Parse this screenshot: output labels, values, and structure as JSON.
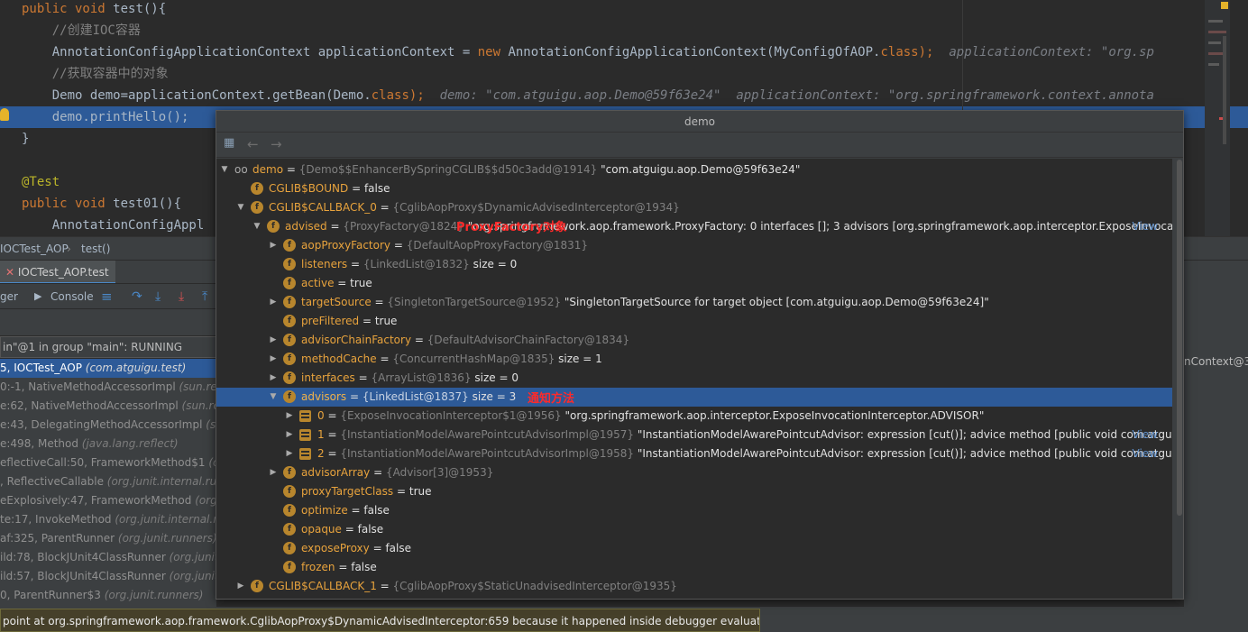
{
  "editor": {
    "lines": [
      {
        "segments": [
          {
            "t": "public void ",
            "c": "kw"
          },
          {
            "t": "test",
            "c": ""
          },
          {
            "t": "(){",
            "c": ""
          }
        ]
      },
      {
        "segments": [
          {
            "t": "    //创建IOC容器",
            "c": "cm"
          }
        ]
      },
      {
        "segments": [
          {
            "t": "    AnnotationConfigApplicationContext applicationContext = ",
            "c": ""
          },
          {
            "t": "new ",
            "c": "kw"
          },
          {
            "t": "AnnotationConfigApplicationContext(MyConfigOfAOP.",
            "c": ""
          },
          {
            "t": "class",
            "c": "kw"
          },
          {
            "t": ");",
            "c": "kw"
          },
          {
            "t": "  applicationContext: \"org.sp",
            "c": "inl"
          }
        ]
      },
      {
        "segments": [
          {
            "t": "    //获取容器中的对象",
            "c": "cm"
          }
        ]
      },
      {
        "segments": [
          {
            "t": "    Demo demo=applicationContext.getBean(Demo.",
            "c": ""
          },
          {
            "t": "class",
            "c": "kw"
          },
          {
            "t": ");",
            "c": "kw"
          },
          {
            "t": "  demo: \"com.atguigu.aop.Demo@59f63e24\"  applicationContext: \"org.springframework.context.annota",
            "c": "inl"
          }
        ]
      },
      {
        "segments": [
          {
            "t": "    demo.printHello();",
            "c": ""
          }
        ]
      },
      {
        "segments": [
          {
            "t": "}",
            "c": ""
          }
        ]
      },
      {
        "segments": [
          {
            "t": "",
            "c": ""
          }
        ]
      },
      {
        "segments": [
          {
            "t": "@Test",
            "c": "an"
          }
        ]
      },
      {
        "segments": [
          {
            "t": "public void ",
            "c": "kw"
          },
          {
            "t": "test01",
            "c": ""
          },
          {
            "t": "(){",
            "c": ""
          }
        ]
      },
      {
        "segments": [
          {
            "t": "    AnnotationConfigAppl",
            "c": ""
          }
        ]
      }
    ]
  },
  "breadcrumb": {
    "class_name": "IOCTest_AOP",
    "separator": "›",
    "method": "test()"
  },
  "run_tab": {
    "label": "IOCTest_AOP.test",
    "close": "×"
  },
  "toolbar": {
    "debugger_label": "ger",
    "console_label": "Console"
  },
  "thread": {
    "text": "in\"@1 in group \"main\": RUNNING"
  },
  "frames": [
    {
      "text": "5, IOCTest_AOP ",
      "pkg": "(com.atguigu.test)",
      "selected": true
    },
    {
      "text": "0:-1, NativeMethodAccessorImpl ",
      "pkg": "(sun.refl"
    },
    {
      "text": "e:62, NativeMethodAccessorImpl ",
      "pkg": "(sun.refle"
    },
    {
      "text": "e:43, DelegatingMethodAccessorImpl ",
      "pkg": "(su"
    },
    {
      "text": "e:498, Method ",
      "pkg": "(java.lang.reflect)"
    },
    {
      "text": "eflectiveCall:50, FrameworkMethod$1 ",
      "pkg": "(org"
    },
    {
      "text": ", ReflectiveCallable ",
      "pkg": "(org.junit.internal.runn"
    },
    {
      "text": "eExplosively:47, FrameworkMethod ",
      "pkg": "(org.ju"
    },
    {
      "text": "te:17, InvokeMethod ",
      "pkg": "(org.junit.internal.ru"
    },
    {
      "text": "af:325, ParentRunner ",
      "pkg": "(org.junit.runners)"
    },
    {
      "text": "ild:78, BlockJUnit4ClassRunner ",
      "pkg": "(org.junit.r"
    },
    {
      "text": "ild:57, BlockJUnit4ClassRunner ",
      "pkg": "(org.junit.r"
    },
    {
      "text": "0, ParentRunner$3 ",
      "pkg": "(org.junit.runners)"
    }
  ],
  "right_pane_text": "nContext@3",
  "popup": {
    "title": "demo",
    "back_glyph": "←",
    "forward_glyph": "→",
    "annotation_proxyfactory": "ProxyFactory对象",
    "annotation_advisors": "通知方法",
    "rows": [
      {
        "indent": 0,
        "arrow": "▼",
        "icon": "watch",
        "name": "demo",
        "eq": " = ",
        "type": "{Demo$$EnhancerBySpringCGLIB$$d50c3add@1914}",
        "value": " \"com.atguigu.aop.Demo@59f63e24\"",
        "view": ""
      },
      {
        "indent": 1,
        "arrow": "",
        "icon": "f",
        "name": "CGLIB$BOUND",
        "eq": " = ",
        "type": "",
        "value": "false",
        "view": ""
      },
      {
        "indent": 1,
        "arrow": "▼",
        "icon": "f",
        "name": "CGLIB$CALLBACK_0",
        "eq": " = ",
        "type": "{CglibAopProxy$DynamicAdvisedInterceptor@1934}",
        "value": "",
        "view": ""
      },
      {
        "indent": 2,
        "arrow": "▼",
        "icon": "f",
        "name": "advised",
        "eq": " = ",
        "type": "{ProxyFactory@1824}",
        "value": " \"org.springframework.aop.framework.ProxyFactory: 0 interfaces []; 3 advisors [org.springframework.aop.interceptor.ExposeInvocat...",
        "view": "View"
      },
      {
        "indent": 3,
        "arrow": "▶",
        "icon": "f",
        "name": "aopProxyFactory",
        "eq": " = ",
        "type": "{DefaultAopProxyFactory@1831}",
        "value": "",
        "view": ""
      },
      {
        "indent": 3,
        "arrow": "",
        "icon": "f",
        "name": "listeners",
        "eq": " = ",
        "type": "{LinkedList@1832}",
        "value": "  size = 0",
        "view": ""
      },
      {
        "indent": 3,
        "arrow": "",
        "icon": "f",
        "name": "active",
        "eq": " = ",
        "type": "",
        "value": "true",
        "view": ""
      },
      {
        "indent": 3,
        "arrow": "▶",
        "icon": "f",
        "name": "targetSource",
        "eq": " = ",
        "type": "{SingletonTargetSource@1952}",
        "value": " \"SingletonTargetSource for target object [com.atguigu.aop.Demo@59f63e24]\"",
        "view": ""
      },
      {
        "indent": 3,
        "arrow": "",
        "icon": "f",
        "name": "preFiltered",
        "eq": " = ",
        "type": "",
        "value": "true",
        "view": ""
      },
      {
        "indent": 3,
        "arrow": "▶",
        "icon": "f",
        "name": "advisorChainFactory",
        "eq": " = ",
        "type": "{DefaultAdvisorChainFactory@1834}",
        "value": "",
        "view": ""
      },
      {
        "indent": 3,
        "arrow": "▶",
        "icon": "f",
        "name": "methodCache",
        "eq": " = ",
        "type": "{ConcurrentHashMap@1835}",
        "value": "  size = 1",
        "view": ""
      },
      {
        "indent": 3,
        "arrow": "▶",
        "icon": "f",
        "name": "interfaces",
        "eq": " = ",
        "type": "{ArrayList@1836}",
        "value": "  size = 0",
        "view": ""
      },
      {
        "indent": 3,
        "arrow": "▼",
        "icon": "f",
        "name": "advisors",
        "eq": " = ",
        "type": "{LinkedList@1837}",
        "value": "  size = 3",
        "view": "",
        "selected": true
      },
      {
        "indent": 4,
        "arrow": "▶",
        "icon": "list",
        "name": "0",
        "eq": " = ",
        "type": "{ExposeInvocationInterceptor$1@1956}",
        "value": " \"org.springframework.aop.interceptor.ExposeInvocationInterceptor.ADVISOR\"",
        "view": ""
      },
      {
        "indent": 4,
        "arrow": "▶",
        "icon": "list",
        "name": "1",
        "eq": " = ",
        "type": "{InstantiationModelAwarePointcutAdvisorImpl@1957}",
        "value": " \"InstantiationModelAwarePointcutAdvisor: expression [cut()]; advice method [public void com.atguig...",
        "view": "View"
      },
      {
        "indent": 4,
        "arrow": "▶",
        "icon": "list",
        "name": "2",
        "eq": " = ",
        "type": "{InstantiationModelAwarePointcutAdvisorImpl@1958}",
        "value": " \"InstantiationModelAwarePointcutAdvisor: expression [cut()]; advice method [public void com.atguig...",
        "view": "View"
      },
      {
        "indent": 3,
        "arrow": "▶",
        "icon": "f",
        "name": "advisorArray",
        "eq": " = ",
        "type": "{Advisor[3]@1953}",
        "value": "",
        "view": ""
      },
      {
        "indent": 3,
        "arrow": "",
        "icon": "f",
        "name": "proxyTargetClass",
        "eq": " = ",
        "type": "",
        "value": "true",
        "view": ""
      },
      {
        "indent": 3,
        "arrow": "",
        "icon": "f",
        "name": "optimize",
        "eq": " = ",
        "type": "",
        "value": "false",
        "view": ""
      },
      {
        "indent": 3,
        "arrow": "",
        "icon": "f",
        "name": "opaque",
        "eq": " = ",
        "type": "",
        "value": "false",
        "view": ""
      },
      {
        "indent": 3,
        "arrow": "",
        "icon": "f",
        "name": "exposeProxy",
        "eq": " = ",
        "type": "",
        "value": "false",
        "view": ""
      },
      {
        "indent": 3,
        "arrow": "",
        "icon": "f",
        "name": "frozen",
        "eq": " = ",
        "type": "",
        "value": "false",
        "view": ""
      },
      {
        "indent": 1,
        "arrow": "▶",
        "icon": "f",
        "name": "CGLIB$CALLBACK_1",
        "eq": " = ",
        "type": "{CglibAopProxy$StaticUnadvisedInterceptor@1935}",
        "value": "",
        "view": ""
      }
    ]
  },
  "notice": "point at org.springframework.aop.framework.CglibAopProxy$DynamicAdvisedInterceptor:659 because it happened inside debugger evaluation",
  "colors": {
    "selection": "#2d5a98",
    "field_icon": "#b8862d",
    "annotation": "#ff2a2a"
  }
}
